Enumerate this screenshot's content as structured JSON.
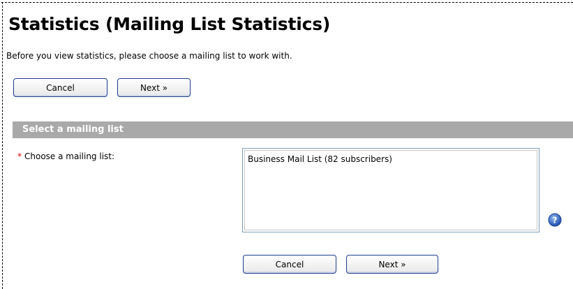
{
  "page": {
    "title": "Statistics (Mailing List Statistics)",
    "intro": "Before you view statistics, please choose a mailing list to work with."
  },
  "top_buttons": {
    "cancel_label": "Cancel",
    "next_label": "Next »"
  },
  "section": {
    "header": "Select a mailing list",
    "required_marker": "*",
    "field_label": "Choose a mailing list:",
    "options": [
      "Business Mail List (82 subscribers)"
    ]
  },
  "bottom_buttons": {
    "cancel_label": "Cancel",
    "next_label": "Next »"
  },
  "icons": {
    "help": "help-question-icon"
  },
  "colors": {
    "section_header_bg": "#a9a9a9",
    "required": "#e00000",
    "button_border": "#1c3d8e",
    "help_icon": "#2d66c7"
  }
}
